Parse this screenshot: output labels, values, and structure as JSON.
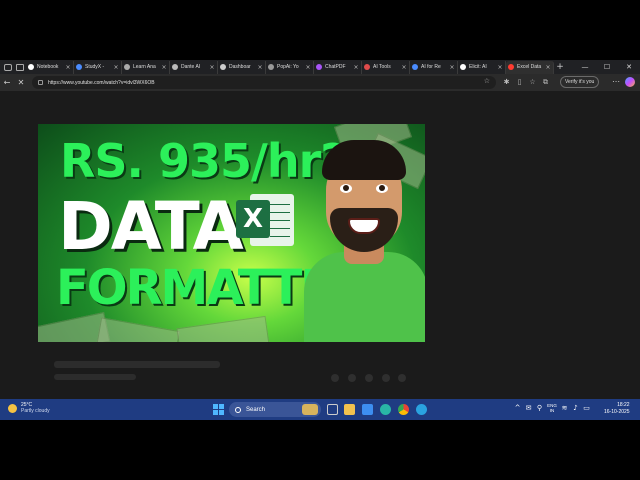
{
  "browser": {
    "tabs": [
      {
        "label": "Notebook",
        "color": "#ffffff"
      },
      {
        "label": "StudyX -",
        "color": "#4a8cff"
      },
      {
        "label": "Learn Ana",
        "color": "#aaaaaa"
      },
      {
        "label": "Dante AI",
        "color": "#bbbbbb"
      },
      {
        "label": "Dashboar",
        "color": "#cccccc"
      },
      {
        "label": "PopAi: Yo",
        "color": "#999999"
      },
      {
        "label": "ChatPDF",
        "color": "#a855f7"
      },
      {
        "label": "AI Tools",
        "color": "#e04b4b"
      },
      {
        "label": "AI for Re",
        "color": "#4a8cff"
      },
      {
        "label": "Elicit: AI",
        "color": "#ffffff"
      },
      {
        "label": "Excel Data",
        "color": "#ff3b30"
      }
    ],
    "active_tab": 10,
    "tab_close_glyph": "×",
    "new_tab_glyph": "+",
    "window_controls": {
      "minimize": "—",
      "maximize": "☐",
      "close": "✕"
    },
    "url": "https://www.youtube.com/watch?v=idvl3WX6OB",
    "verify_label": "Verify it's you"
  },
  "video": {
    "thumbnail_line1": "RS. 935/hr?",
    "thumbnail_line2": "DATA",
    "thumbnail_line3": "FORMATTING",
    "excel_letter": "X",
    "colors": {
      "green_text": "#2cf05a",
      "excel_green": "#1d6f42"
    }
  },
  "taskbar": {
    "weather_temp": "25°C",
    "weather_desc": "Partly cloudy",
    "search_label": "Search",
    "lang_line1": "ENG",
    "lang_line2": "IN",
    "time": "18:22",
    "date": "16-10-2025"
  }
}
